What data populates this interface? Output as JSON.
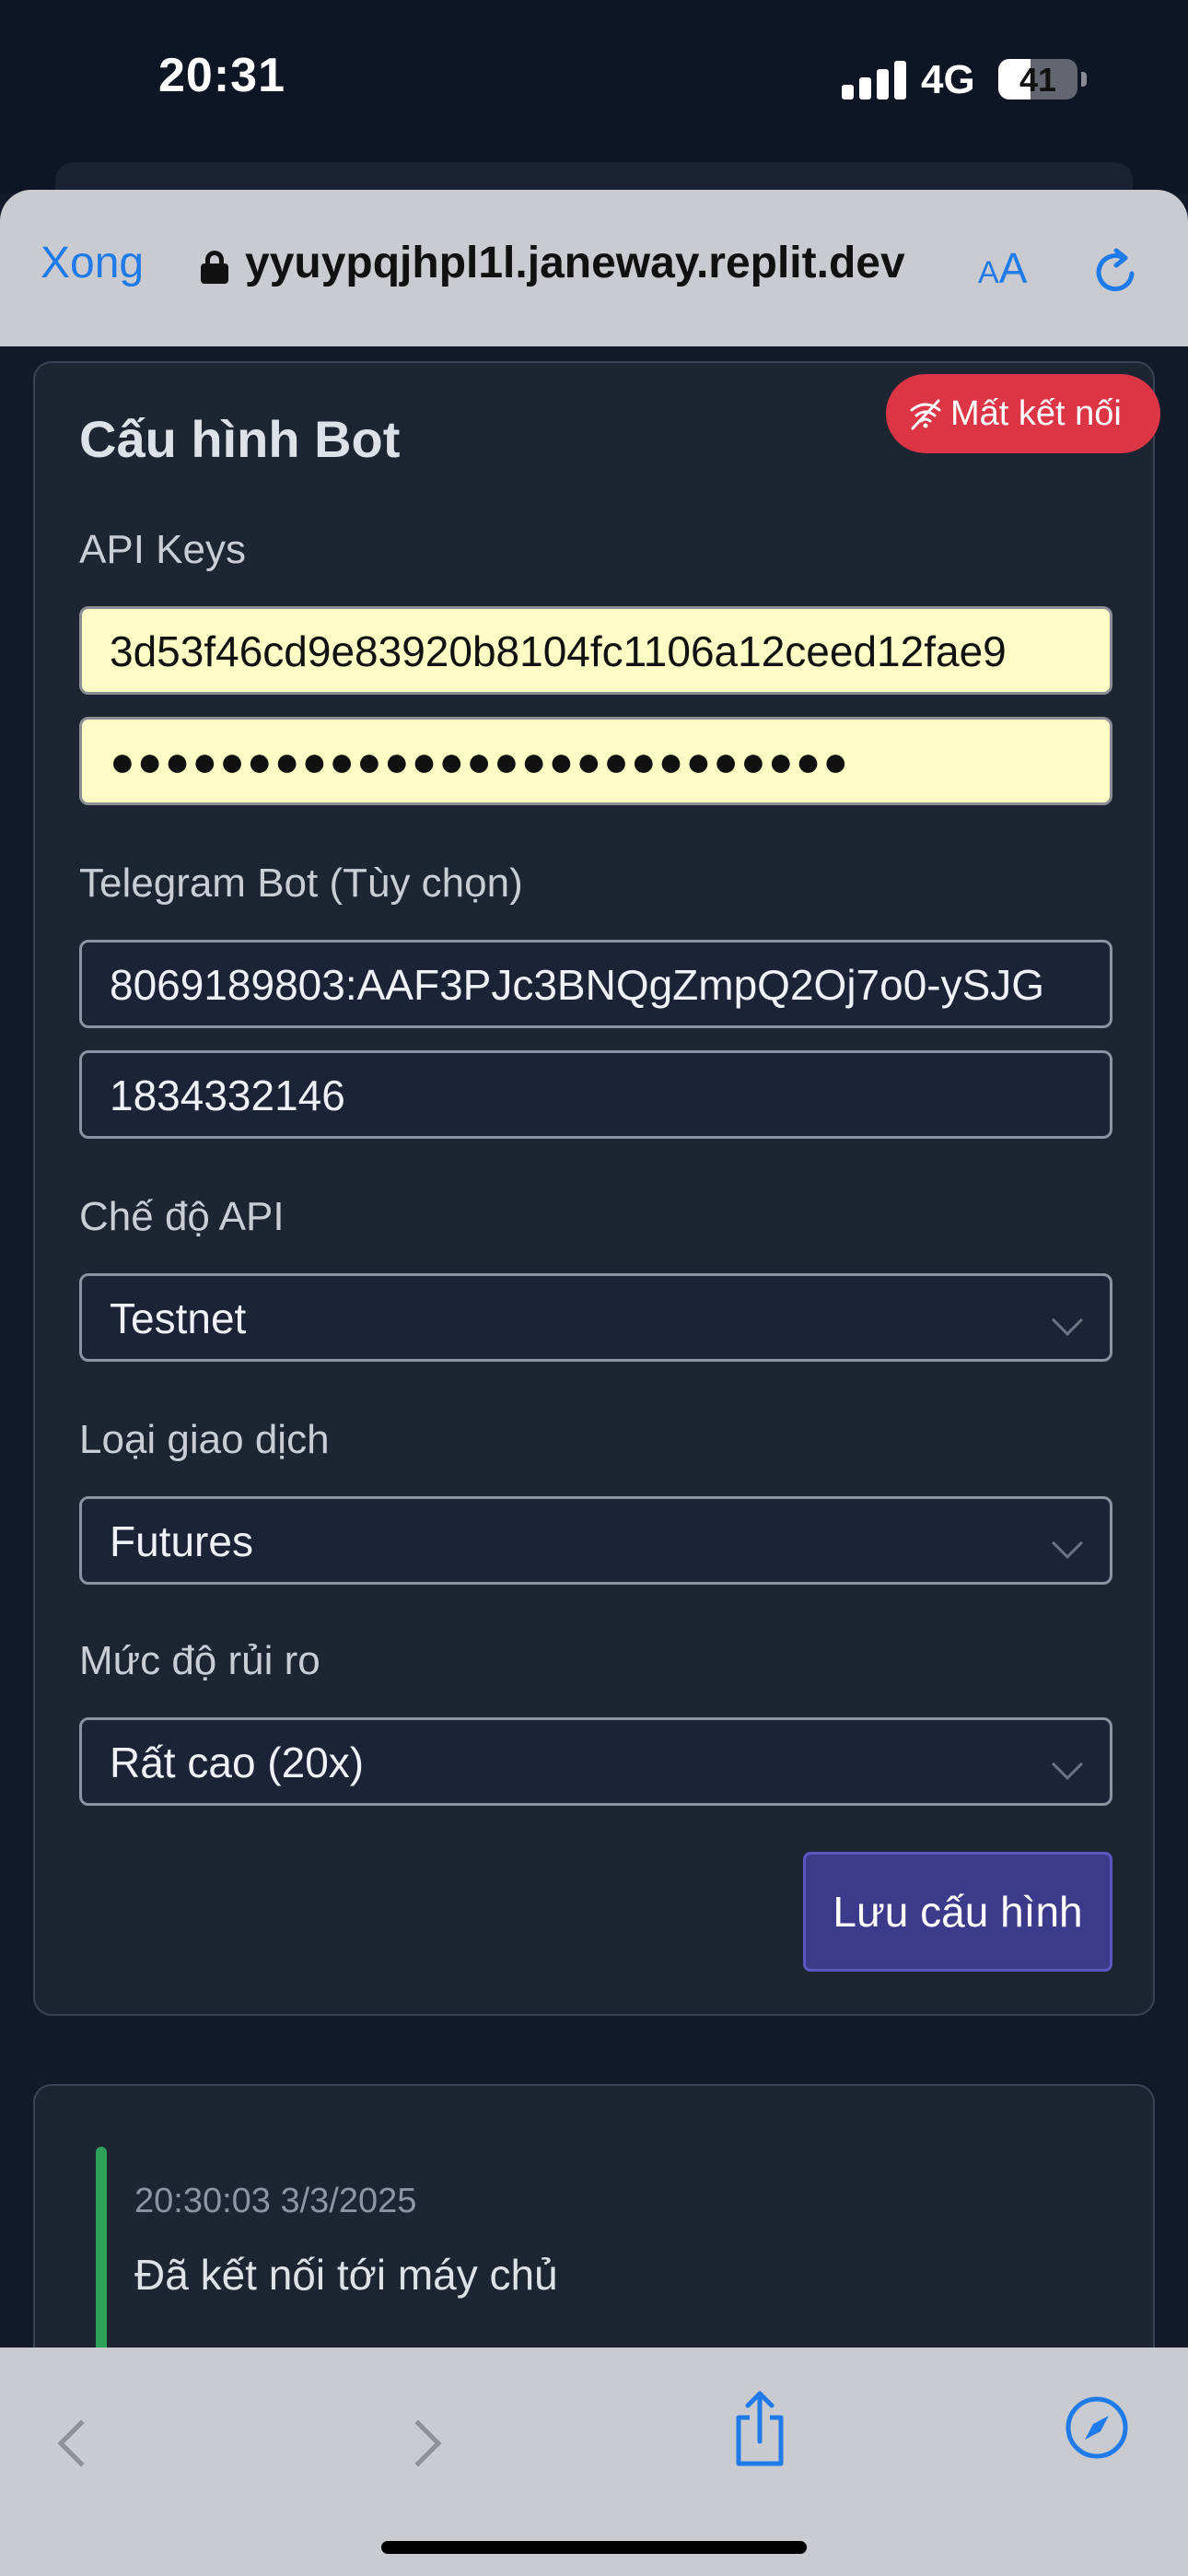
{
  "status_bar": {
    "time": "20:31",
    "network": "4G",
    "battery": "41",
    "battery_level_percent": 41
  },
  "browser": {
    "done_label": "Xong",
    "url": "yyuypqjhpl1l.janeway.replit.dev",
    "reader_label_small": "A",
    "reader_label_big": "A"
  },
  "connection_badge": {
    "label": "Mất kết nối",
    "color": "#dc3545"
  },
  "config": {
    "title": "Cấu hình Bot",
    "api_keys_label": "API Keys",
    "api_key_value": "3d53f46cd9e83920b8104fc1106a12ceed12fae9",
    "api_secret_masked": "●●●●●●●●●●●●●●●●●●●●●●●●●●●",
    "telegram_label": "Telegram Bot (Tùy chọn)",
    "telegram_token": "8069189803:AAF3PJc3BNQgZmpQ2Oj7o0-ySJG",
    "telegram_chat_id": "1834332146",
    "api_mode_label": "Chế độ API",
    "api_mode_value": "Testnet",
    "trade_type_label": "Loại giao dịch",
    "trade_type_value": "Futures",
    "risk_label": "Mức độ rủi ro",
    "risk_value": "Rất cao (20x)",
    "save_label": "Lưu cấu hình",
    "accent_color": "#3c3a8a"
  },
  "log": {
    "entries": [
      {
        "time": "20:30:03 3/3/2025",
        "message": "Đã kết nối tới máy chủ",
        "color": "#2fa25a"
      }
    ]
  }
}
